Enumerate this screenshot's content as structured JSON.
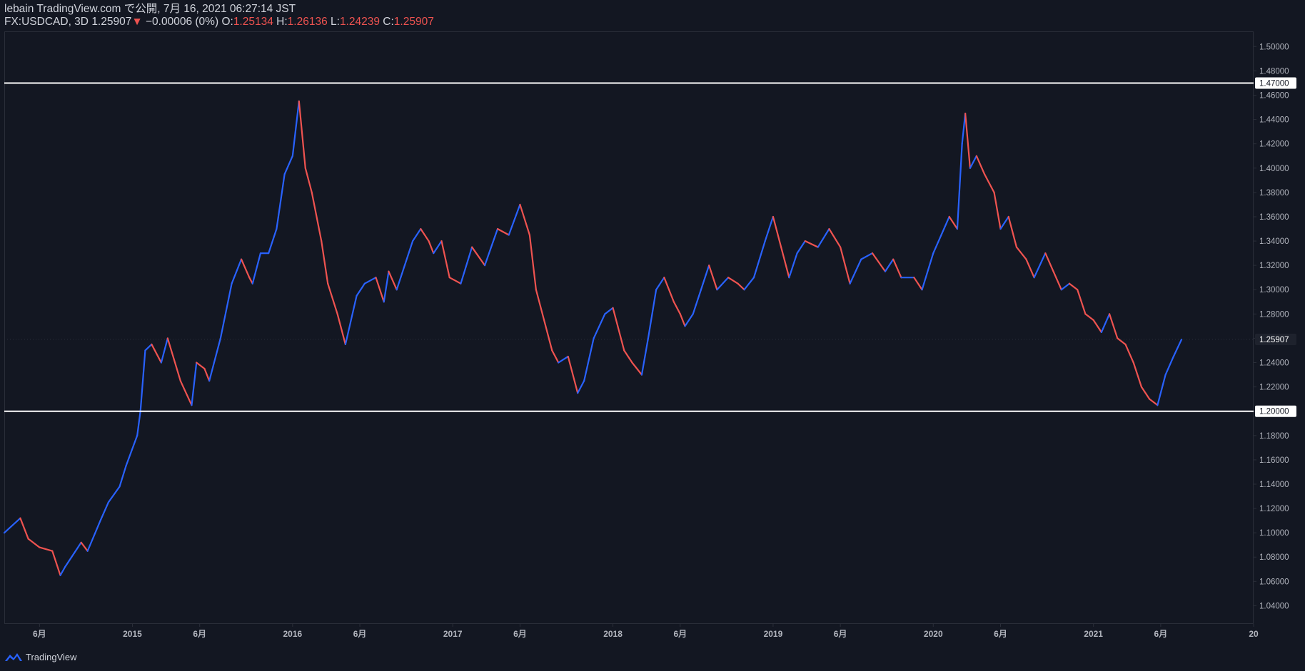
{
  "header": {
    "publish_line": "lebain TradingView.com で公開, 7月 16, 2021 06:27:14 JST",
    "symbol": "FX:USDCAD, 3D",
    "last": "1.25907",
    "change_arrow": "▼",
    "change": "−0.00006 (0%)",
    "o_label": "O:",
    "o_val": "1.25134",
    "h_label": "H:",
    "h_val": "1.26136",
    "l_label": "L:",
    "l_val": "1.24239",
    "c_label": "C:",
    "c_val": "1.25907"
  },
  "footer": {
    "brand": "TradingView",
    "logo_icon": "tradingview-logo-icon"
  },
  "colors": {
    "background": "#131722",
    "up": "#2962ff",
    "down": "#ef5350",
    "line": "#ffffff",
    "axis_text": "#b2b5be"
  },
  "chart_data": {
    "type": "line",
    "title": "",
    "price_axis": {
      "ylim": [
        1.025,
        1.5125
      ],
      "ticks": [
        "1.50000",
        "1.48000",
        "1.46000",
        "1.44000",
        "1.42000",
        "1.40000",
        "1.38000",
        "1.36000",
        "1.34000",
        "1.32000",
        "1.30000",
        "1.28000",
        "1.26000",
        "1.24000",
        "1.22000",
        "1.20000",
        "1.18000",
        "1.16000",
        "1.14000",
        "1.12000",
        "1.10000",
        "1.08000",
        "1.06000",
        "1.04000"
      ],
      "tick_values": [
        1.5,
        1.48,
        1.46,
        1.44,
        1.42,
        1.4,
        1.38,
        1.36,
        1.34,
        1.32,
        1.3,
        1.28,
        1.26,
        1.24,
        1.22,
        1.2,
        1.18,
        1.16,
        1.14,
        1.12,
        1.1,
        1.08,
        1.06,
        1.04
      ]
    },
    "time_axis": {
      "xlim": [
        2014.2,
        2022.0
      ],
      "ticks": [
        {
          "label": "6月",
          "x": 2014.42
        },
        {
          "label": "2015",
          "x": 2015.0
        },
        {
          "label": "6月",
          "x": 2015.42
        },
        {
          "label": "2016",
          "x": 2016.0
        },
        {
          "label": "6月",
          "x": 2016.42
        },
        {
          "label": "2017",
          "x": 2017.0
        },
        {
          "label": "6月",
          "x": 2017.42
        },
        {
          "label": "2018",
          "x": 2018.0
        },
        {
          "label": "6月",
          "x": 2018.42
        },
        {
          "label": "2019",
          "x": 2019.0
        },
        {
          "label": "6月",
          "x": 2019.42
        },
        {
          "label": "2020",
          "x": 2020.0
        },
        {
          "label": "6月",
          "x": 2020.42
        },
        {
          "label": "2021",
          "x": 2021.0
        },
        {
          "label": "6月",
          "x": 2021.42
        },
        {
          "label": "20",
          "x": 2022.0
        }
      ]
    },
    "horizontal_lines": [
      {
        "label": "1.47000",
        "value": 1.47
      },
      {
        "label": "1.20000",
        "value": 1.2
      }
    ],
    "last_price": {
      "label": "1.25907",
      "value": 1.25907
    },
    "series": [
      {
        "x": [
          2014.2,
          2014.3,
          2014.35,
          2014.42,
          2014.5,
          2014.55,
          2014.58,
          2014.62,
          2014.68,
          2014.72,
          2014.8,
          2014.85,
          2014.92,
          2014.96,
          2015.03,
          2015.05,
          2015.08,
          2015.12,
          2015.18,
          2015.22,
          2015.3,
          2015.37,
          2015.4,
          2015.45,
          2015.48,
          2015.55,
          2015.62,
          2015.68,
          2015.73,
          2015.75,
          2015.8,
          2015.85,
          2015.9,
          2015.95,
          2016.0,
          2016.04,
          2016.08,
          2016.12,
          2016.18,
          2016.22,
          2016.28,
          2016.33,
          2016.4,
          2016.45,
          2016.52,
          2016.57,
          2016.6,
          2016.65,
          2016.7,
          2016.75,
          2016.8,
          2016.85,
          2016.88,
          2016.93,
          2016.98,
          2017.05,
          2017.12,
          2017.2,
          2017.28,
          2017.35,
          2017.42,
          2017.48,
          2017.52,
          2017.58,
          2017.62,
          2017.66,
          2017.72,
          2017.78,
          2017.82,
          2017.88,
          2017.95,
          2018.0,
          2018.03,
          2018.07,
          2018.12,
          2018.18,
          2018.22,
          2018.27,
          2018.32,
          2018.38,
          2018.42,
          2018.45,
          2018.5,
          2018.55,
          2018.6,
          2018.65,
          2018.72,
          2018.78,
          2018.82,
          2018.88,
          2018.95,
          2019.0,
          2019.05,
          2019.1,
          2019.15,
          2019.2,
          2019.28,
          2019.35,
          2019.42,
          2019.48,
          2019.55,
          2019.62,
          2019.7,
          2019.75,
          2019.8,
          2019.88,
          2019.93,
          2020.0,
          2020.05,
          2020.1,
          2020.15,
          2020.18,
          2020.2,
          2020.23,
          2020.27,
          2020.32,
          2020.38,
          2020.42,
          2020.47,
          2020.52,
          2020.58,
          2020.63,
          2020.7,
          2020.75,
          2020.8,
          2020.85,
          2020.9,
          2020.95,
          2021.0,
          2021.05,
          2021.1,
          2021.15,
          2021.2,
          2021.25,
          2021.3,
          2021.35,
          2021.4,
          2021.45,
          2021.5,
          2021.55
        ],
        "y": [
          1.1,
          1.112,
          1.095,
          1.088,
          1.085,
          1.065,
          1.072,
          1.08,
          1.092,
          1.085,
          1.11,
          1.125,
          1.138,
          1.155,
          1.18,
          1.2,
          1.25,
          1.255,
          1.24,
          1.26,
          1.225,
          1.205,
          1.24,
          1.235,
          1.225,
          1.26,
          1.305,
          1.325,
          1.31,
          1.305,
          1.33,
          1.33,
          1.35,
          1.395,
          1.41,
          1.455,
          1.4,
          1.38,
          1.34,
          1.305,
          1.28,
          1.255,
          1.295,
          1.305,
          1.31,
          1.29,
          1.315,
          1.3,
          1.32,
          1.34,
          1.35,
          1.34,
          1.33,
          1.34,
          1.31,
          1.305,
          1.335,
          1.32,
          1.35,
          1.345,
          1.37,
          1.345,
          1.3,
          1.27,
          1.25,
          1.24,
          1.245,
          1.215,
          1.225,
          1.26,
          1.28,
          1.285,
          1.27,
          1.25,
          1.24,
          1.23,
          1.26,
          1.3,
          1.31,
          1.29,
          1.28,
          1.27,
          1.28,
          1.3,
          1.32,
          1.3,
          1.31,
          1.305,
          1.3,
          1.31,
          1.34,
          1.36,
          1.335,
          1.31,
          1.33,
          1.34,
          1.335,
          1.35,
          1.335,
          1.305,
          1.325,
          1.33,
          1.315,
          1.325,
          1.31,
          1.31,
          1.3,
          1.33,
          1.345,
          1.36,
          1.35,
          1.42,
          1.445,
          1.4,
          1.41,
          1.395,
          1.38,
          1.35,
          1.36,
          1.335,
          1.325,
          1.31,
          1.33,
          1.315,
          1.3,
          1.305,
          1.3,
          1.28,
          1.275,
          1.265,
          1.28,
          1.26,
          1.255,
          1.24,
          1.22,
          1.21,
          1.205,
          1.23,
          1.245,
          1.259
        ]
      }
    ]
  }
}
